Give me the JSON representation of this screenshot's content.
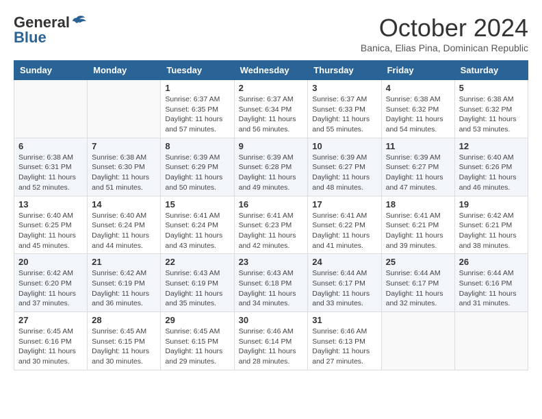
{
  "header": {
    "logo_general": "General",
    "logo_blue": "Blue",
    "month": "October 2024",
    "location": "Banica, Elias Pina, Dominican Republic"
  },
  "days_of_week": [
    "Sunday",
    "Monday",
    "Tuesday",
    "Wednesday",
    "Thursday",
    "Friday",
    "Saturday"
  ],
  "weeks": [
    [
      {
        "day": "",
        "info": ""
      },
      {
        "day": "",
        "info": ""
      },
      {
        "day": "1",
        "info": "Sunrise: 6:37 AM\nSunset: 6:35 PM\nDaylight: 11 hours\nand 57 minutes."
      },
      {
        "day": "2",
        "info": "Sunrise: 6:37 AM\nSunset: 6:34 PM\nDaylight: 11 hours\nand 56 minutes."
      },
      {
        "day": "3",
        "info": "Sunrise: 6:37 AM\nSunset: 6:33 PM\nDaylight: 11 hours\nand 55 minutes."
      },
      {
        "day": "4",
        "info": "Sunrise: 6:38 AM\nSunset: 6:32 PM\nDaylight: 11 hours\nand 54 minutes."
      },
      {
        "day": "5",
        "info": "Sunrise: 6:38 AM\nSunset: 6:32 PM\nDaylight: 11 hours\nand 53 minutes."
      }
    ],
    [
      {
        "day": "6",
        "info": "Sunrise: 6:38 AM\nSunset: 6:31 PM\nDaylight: 11 hours\nand 52 minutes."
      },
      {
        "day": "7",
        "info": "Sunrise: 6:38 AM\nSunset: 6:30 PM\nDaylight: 11 hours\nand 51 minutes."
      },
      {
        "day": "8",
        "info": "Sunrise: 6:39 AM\nSunset: 6:29 PM\nDaylight: 11 hours\nand 50 minutes."
      },
      {
        "day": "9",
        "info": "Sunrise: 6:39 AM\nSunset: 6:28 PM\nDaylight: 11 hours\nand 49 minutes."
      },
      {
        "day": "10",
        "info": "Sunrise: 6:39 AM\nSunset: 6:27 PM\nDaylight: 11 hours\nand 48 minutes."
      },
      {
        "day": "11",
        "info": "Sunrise: 6:39 AM\nSunset: 6:27 PM\nDaylight: 11 hours\nand 47 minutes."
      },
      {
        "day": "12",
        "info": "Sunrise: 6:40 AM\nSunset: 6:26 PM\nDaylight: 11 hours\nand 46 minutes."
      }
    ],
    [
      {
        "day": "13",
        "info": "Sunrise: 6:40 AM\nSunset: 6:25 PM\nDaylight: 11 hours\nand 45 minutes."
      },
      {
        "day": "14",
        "info": "Sunrise: 6:40 AM\nSunset: 6:24 PM\nDaylight: 11 hours\nand 44 minutes."
      },
      {
        "day": "15",
        "info": "Sunrise: 6:41 AM\nSunset: 6:24 PM\nDaylight: 11 hours\nand 43 minutes."
      },
      {
        "day": "16",
        "info": "Sunrise: 6:41 AM\nSunset: 6:23 PM\nDaylight: 11 hours\nand 42 minutes."
      },
      {
        "day": "17",
        "info": "Sunrise: 6:41 AM\nSunset: 6:22 PM\nDaylight: 11 hours\nand 41 minutes."
      },
      {
        "day": "18",
        "info": "Sunrise: 6:41 AM\nSunset: 6:21 PM\nDaylight: 11 hours\nand 39 minutes."
      },
      {
        "day": "19",
        "info": "Sunrise: 6:42 AM\nSunset: 6:21 PM\nDaylight: 11 hours\nand 38 minutes."
      }
    ],
    [
      {
        "day": "20",
        "info": "Sunrise: 6:42 AM\nSunset: 6:20 PM\nDaylight: 11 hours\nand 37 minutes."
      },
      {
        "day": "21",
        "info": "Sunrise: 6:42 AM\nSunset: 6:19 PM\nDaylight: 11 hours\nand 36 minutes."
      },
      {
        "day": "22",
        "info": "Sunrise: 6:43 AM\nSunset: 6:19 PM\nDaylight: 11 hours\nand 35 minutes."
      },
      {
        "day": "23",
        "info": "Sunrise: 6:43 AM\nSunset: 6:18 PM\nDaylight: 11 hours\nand 34 minutes."
      },
      {
        "day": "24",
        "info": "Sunrise: 6:44 AM\nSunset: 6:17 PM\nDaylight: 11 hours\nand 33 minutes."
      },
      {
        "day": "25",
        "info": "Sunrise: 6:44 AM\nSunset: 6:17 PM\nDaylight: 11 hours\nand 32 minutes."
      },
      {
        "day": "26",
        "info": "Sunrise: 6:44 AM\nSunset: 6:16 PM\nDaylight: 11 hours\nand 31 minutes."
      }
    ],
    [
      {
        "day": "27",
        "info": "Sunrise: 6:45 AM\nSunset: 6:16 PM\nDaylight: 11 hours\nand 30 minutes."
      },
      {
        "day": "28",
        "info": "Sunrise: 6:45 AM\nSunset: 6:15 PM\nDaylight: 11 hours\nand 30 minutes."
      },
      {
        "day": "29",
        "info": "Sunrise: 6:45 AM\nSunset: 6:15 PM\nDaylight: 11 hours\nand 29 minutes."
      },
      {
        "day": "30",
        "info": "Sunrise: 6:46 AM\nSunset: 6:14 PM\nDaylight: 11 hours\nand 28 minutes."
      },
      {
        "day": "31",
        "info": "Sunrise: 6:46 AM\nSunset: 6:13 PM\nDaylight: 11 hours\nand 27 minutes."
      },
      {
        "day": "",
        "info": ""
      },
      {
        "day": "",
        "info": ""
      }
    ]
  ]
}
